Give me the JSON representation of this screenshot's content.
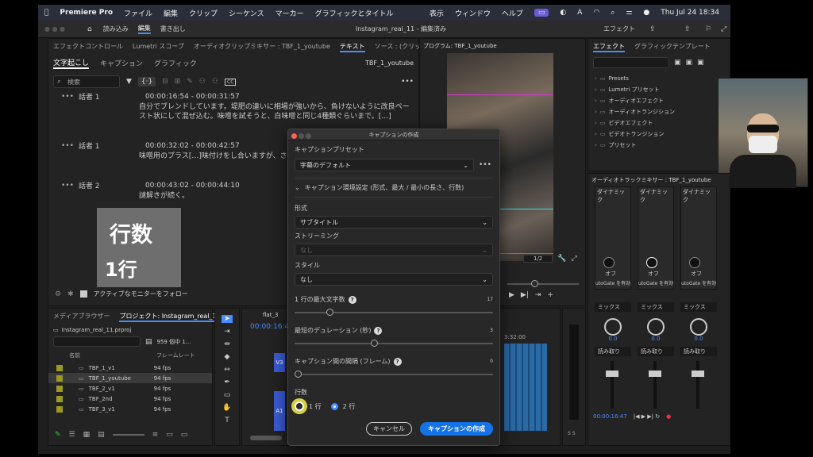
{
  "menubar": {
    "app": "Premiere Pro",
    "items": [
      "ファイル",
      "編集",
      "クリップ",
      "シーケンス",
      "マーカー",
      "グラフィックとタイトル"
    ],
    "right_items": [
      "表示",
      "ウィンドウ",
      "ヘルプ"
    ],
    "clock": "Thu Jul 24  18:34"
  },
  "titlebar": {
    "workspaces": [
      "読み込み",
      "編集",
      "書き出し"
    ],
    "active_workspace": "編集",
    "title": "Instagram_real_11 - 編集済み",
    "effects_label": "エフェクト"
  },
  "left_panel": {
    "top_tabs": [
      "エフェクトコントロール",
      "Lumetri スコープ",
      "オーディオクリップミキサー : TBF_1_youtube",
      "テキスト",
      "ソース : (クリップ"
    ],
    "sub_tabs": [
      "文字起こし",
      "キャプション",
      "グラフィック"
    ],
    "sequence": "TBF_1_youtube",
    "search_placeholder": "検索",
    "transcript": [
      {
        "speaker": "話者 1",
        "time": "00:00:16:54 - 00:00:31:57",
        "text": "自分でブレンドしています。堤肥の違いに相場が強いから、負けないように改良ペースト状にして混ぜ込む。味噌を試そうと、白味噌と同じ4種類ぐらいまで。[…]"
      },
      {
        "speaker": "話者 1",
        "time": "00:00:32:02 - 00:00:42:57",
        "text": "味噌用のプラス[…]味付けをし合いますが、さらに合う"
      },
      {
        "speaker": "話者 2",
        "time": "00:00:43:02 - 00:00:44:10",
        "text": "謎解きが続く。"
      }
    ],
    "follow_label": "アクティブなモニターをフォロー"
  },
  "overlay": {
    "line1": "行数",
    "line2": "1行"
  },
  "program": {
    "title": "プログラム: TBF_1_youtube",
    "zoom": "1/2",
    "timecode": "00:00:16:47"
  },
  "effects_panel": {
    "tabs": [
      "エフェクト",
      "グラフィックテンプレート"
    ],
    "items": [
      "Presets",
      "Lumetri プリセット",
      "オーディオエフェクト",
      "オーディオトランジション",
      "ビデオエフェクト",
      "ビデオトランジション",
      "プリセット"
    ]
  },
  "mixer": {
    "title": "オーディオトラックミキサー : TBF_1_youtube",
    "channels": [
      {
        "name": "ダイナミック",
        "state": "オフ",
        "gate": "utoGate を有効",
        "mode": "ミックス",
        "read": "読み取り",
        "value": "0.0"
      },
      {
        "name": "ダイナミック",
        "state": "オフ",
        "gate": "utoGate を有効",
        "mode": "ミックス",
        "read": "読み取り",
        "value": "0.0"
      },
      {
        "name": "ダイナミック",
        "state": "オフ",
        "gate": "utoGate を有効",
        "mode": "ミックス",
        "read": "読み取り",
        "value": "0.0"
      }
    ],
    "timecode": "00:00:16:47"
  },
  "project": {
    "tabs": [
      "メディアブラウザー",
      "プロジェクト: Instagram_real_11"
    ],
    "file": "Instagram_real_11.prproj",
    "count": "959 個中 1...",
    "col_name": "名前",
    "col_rate": "フレームレート",
    "items": [
      {
        "name": "TBF_1_v1",
        "rate": "94 fps"
      },
      {
        "name": "TBF_1_youtube",
        "rate": "94 fps"
      },
      {
        "name": "TBF_2_v1",
        "rate": "94 fps"
      },
      {
        "name": "TBF_2nd",
        "rate": "94 fps"
      },
      {
        "name": "TBF_3_v1",
        "rate": "94 fps"
      }
    ]
  },
  "timeline": {
    "tab": "flat_3",
    "timecode": "00:00:16:4",
    "time2": "3:32:00",
    "tracks": [
      "V3",
      "A1"
    ]
  },
  "dialog": {
    "title": "キャプションの作成",
    "preset_label": "キャプションプリセット",
    "preset_value": "字幕のデフォルト",
    "section_label": "キャプション環境設定 (形式、最大 / 最小の長さ、行数)",
    "format_label": "形式",
    "format_value": "サブタイトル",
    "streaming_label": "ストリーミング",
    "streaming_value": "なし",
    "style_label": "スタイル",
    "style_value": "なし",
    "max_chars_label": "1 行の最大文字数",
    "max_chars_value": "17",
    "min_duration_label": "最短のデュレーション (秒)",
    "min_duration_value": "3",
    "gap_label": "キャプション間の間隔 (フレーム)",
    "gap_value": "0",
    "lines_label": "行数",
    "line1": "1 行",
    "line2": "2 行",
    "cancel": "キャンセル",
    "create": "キャプションの作成"
  }
}
